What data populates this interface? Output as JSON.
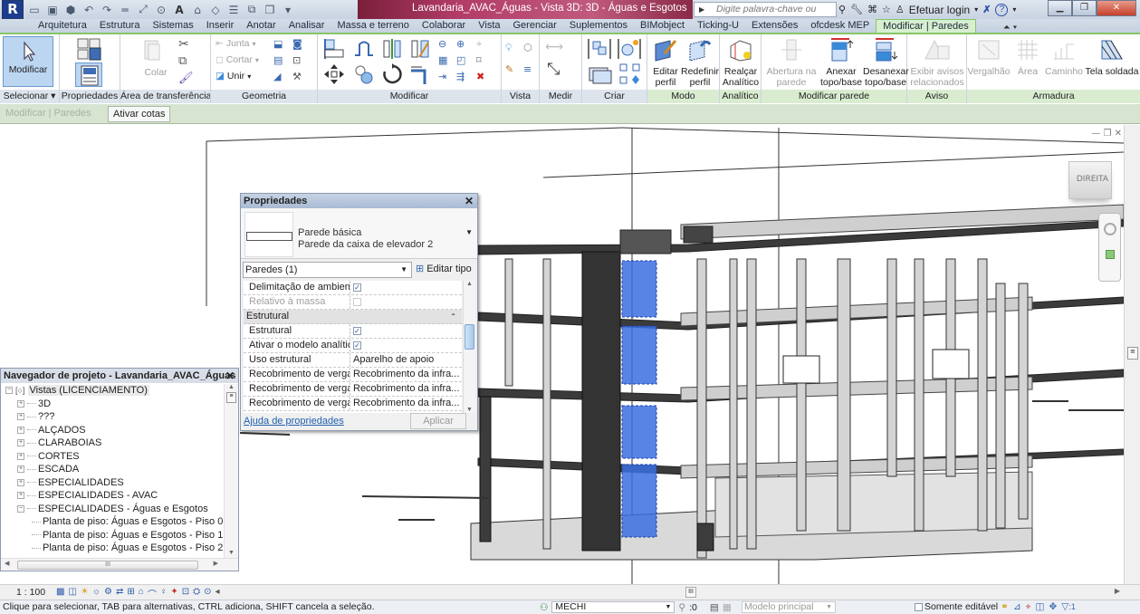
{
  "titlebar": {
    "app_logo": "R",
    "window_title": "Lavandaria_AVAC_Águas - Vista 3D: 3D - Águas e Esgotos",
    "search_placeholder": "Digite palavra-chave ou frase",
    "login_label": "Efetuar login",
    "qat_icons": [
      "open-icon",
      "save-icon",
      "sync-icon",
      "undo-icon",
      "redo-icon",
      "measure-icon",
      "dimension-icon",
      "tag-icon",
      "text-icon",
      "3d-view-icon",
      "section-icon",
      "thin-lines-icon",
      "close-hidden-icon",
      "switch-windows-icon",
      "customize-icon"
    ]
  },
  "tabs": [
    {
      "label": "Arquitetura",
      "active": false
    },
    {
      "label": "Estrutura",
      "active": false
    },
    {
      "label": "Sistemas",
      "active": false
    },
    {
      "label": "Inserir",
      "active": false
    },
    {
      "label": "Anotar",
      "active": false
    },
    {
      "label": "Analisar",
      "active": false
    },
    {
      "label": "Massa e terreno",
      "active": false
    },
    {
      "label": "Colaborar",
      "active": false
    },
    {
      "label": "Vista",
      "active": false
    },
    {
      "label": "Gerenciar",
      "active": false
    },
    {
      "label": "Suplementos",
      "active": false
    },
    {
      "label": "BIMobject",
      "active": false
    },
    {
      "label": "Ticking-U",
      "active": false
    },
    {
      "label": "Extensões",
      "active": false
    },
    {
      "label": "ofcdesk MEP",
      "active": false
    },
    {
      "label": "Modificar | Paredes",
      "active": true
    }
  ],
  "ribbon": {
    "panels": {
      "selecionar": "Selecionar ▾",
      "propriedades": "Propriedades",
      "transferencia": "Área de transferência",
      "geometria": "Geometria",
      "modificar": "Modificar",
      "vista": "Vista",
      "medir": "Medir",
      "criar": "Criar",
      "modo": "Modo",
      "analitico": "Analítico",
      "modificar_parede": "Modificar parede",
      "aviso": "Aviso",
      "armadura": "Armadura"
    },
    "buttons": {
      "modificar": "Modificar",
      "colar": "Colar",
      "junta": "Junta",
      "cortar": "Cortar",
      "unir": "Unir",
      "editar_perfil_1": "Editar",
      "editar_perfil_2": "perfil",
      "redefinir_perfil_1": "Redefinir",
      "redefinir_perfil_2": "perfil",
      "realcar_1": "Realçar",
      "realcar_2": "Analítico",
      "abertura_1": "Abertura na",
      "abertura_2": "parede",
      "anexar_1": "Anexar",
      "anexar_2": "topo/base",
      "desanexar_1": "Desanexar",
      "desanexar_2": "topo/base",
      "avisos_1": "Exibir avisos",
      "avisos_2": "relacionados",
      "vergalhao": "Vergalhão",
      "area": "Área",
      "caminho": "Caminho",
      "tela_soldada": "Tela soldada"
    }
  },
  "optionsbar": {
    "context": "Modificar | Paredes",
    "ativar_cotas": "Ativar cotas"
  },
  "properties": {
    "title": "Propriedades",
    "type_family": "Parede básica",
    "type_name": "Parede da caixa de elevador 2",
    "filter": "Paredes (1)",
    "edit_type": "Editar tipo",
    "rows": [
      {
        "name": "Delimitação de ambient...",
        "value": "",
        "checkbox": true,
        "checked": true,
        "disabled": false
      },
      {
        "name": "Relativo à massa",
        "value": "",
        "checkbox": true,
        "checked": false,
        "disabled": true
      },
      {
        "group": "Estrutural"
      },
      {
        "name": "Estrutural",
        "value": "",
        "checkbox": true,
        "checked": true,
        "disabled": false
      },
      {
        "name": "Ativar o modelo analítico",
        "value": "",
        "checkbox": true,
        "checked": true,
        "disabled": false
      },
      {
        "name": "Uso estrutural",
        "value": "Aparelho de apoio",
        "checkbox": false,
        "disabled": false
      },
      {
        "name": "Recobrimento de vergal...",
        "value": "Recobrimento da infra...",
        "checkbox": false,
        "disabled": false
      },
      {
        "name": "Recobrimento de vergal...",
        "value": "Recobrimento da infra...",
        "checkbox": false,
        "disabled": false
      },
      {
        "name": "Recobrimento de vergal...",
        "value": "Recobrimento da infra...",
        "checkbox": false,
        "disabled": false
      }
    ],
    "help_link": "Ajuda de propriedades",
    "apply": "Aplicar"
  },
  "browser": {
    "title": "Navegador de projeto - Lavandaria_AVAC_Águas",
    "root": "Vistas (LICENCIAMENTO)",
    "nodes": [
      {
        "label": "3D",
        "expanded": false
      },
      {
        "label": "???",
        "expanded": false
      },
      {
        "label": "ALÇADOS",
        "expanded": false
      },
      {
        "label": "CLARABOIAS",
        "expanded": false
      },
      {
        "label": "CORTES",
        "expanded": false
      },
      {
        "label": "ESCADA",
        "expanded": false
      },
      {
        "label": "ESPECIALIDADES",
        "expanded": false
      },
      {
        "label": "ESPECIALIDADES - AVAC",
        "expanded": false
      },
      {
        "label": "ESPECIALIDADES - Águas e Esgotos",
        "expanded": true
      }
    ],
    "children": [
      "Planta de piso: Águas e Esgotos - Piso 0",
      "Planta de piso: Águas e Esgotos - Piso 1",
      "Planta de piso: Águas e Esgotos - Piso 2"
    ]
  },
  "viewport": {
    "viewcube_label": "DIREITA",
    "view_controls": "— ❐ ✕",
    "selection_color": "#3b6fe0"
  },
  "viewbar": {
    "scale": "1 : 100"
  },
  "statusbar": {
    "text": "Clique para selecionar, TAB para alternativas, CTRL adiciona, SHIFT cancela a seleção.",
    "workset": "MECHI",
    "workset_count": ":0",
    "design_option": "Modelo principal",
    "editable_only": "Somente editável",
    "filter_count": ":1"
  }
}
